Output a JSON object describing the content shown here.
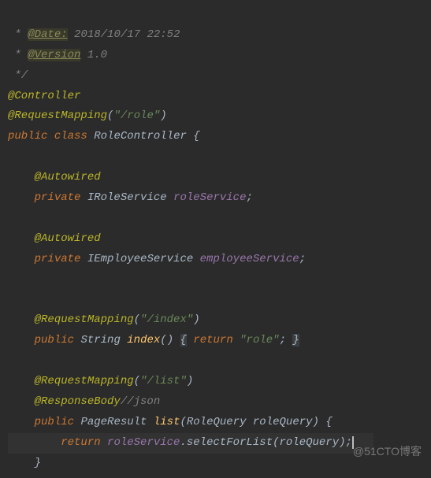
{
  "doc": {
    "date_tag": "@Date:",
    "date_val": "2018/10/17 22:52",
    "version_tag": "@Version",
    "version_val": "1.0",
    "end": "*/"
  },
  "anno": {
    "controller": "@Controller",
    "request_mapping": "@RequestMapping",
    "autowired": "@Autowired",
    "response_body": "@ResponseBody"
  },
  "kw": {
    "public": "public",
    "class": "class",
    "private": "private",
    "return": "return"
  },
  "cls": {
    "name": "RoleController",
    "irole": "IRoleService",
    "iemp": "IEmployeeService",
    "string": "String",
    "pageresult": "PageResult",
    "rolequery": "RoleQuery"
  },
  "fld": {
    "roleService": "roleService",
    "employeeService": "employeeService"
  },
  "str": {
    "role_path": "\"/role\"",
    "index_path": "\"/index\"",
    "list_path": "\"/list\"",
    "role_lit": "\"role\""
  },
  "mth": {
    "index": "index",
    "list": "list",
    "selectForList": "selectForList"
  },
  "param": {
    "roleQuery": "roleQuery"
  },
  "cmt": {
    "json": "//json"
  },
  "sym": {
    "star": " * ",
    "star2": " ",
    "lparen": "(",
    "rparen": ")",
    "lbrace": "{",
    "rbrace": "}",
    "semi": ";",
    "dot": "."
  },
  "watermark": "@51CTO博客"
}
